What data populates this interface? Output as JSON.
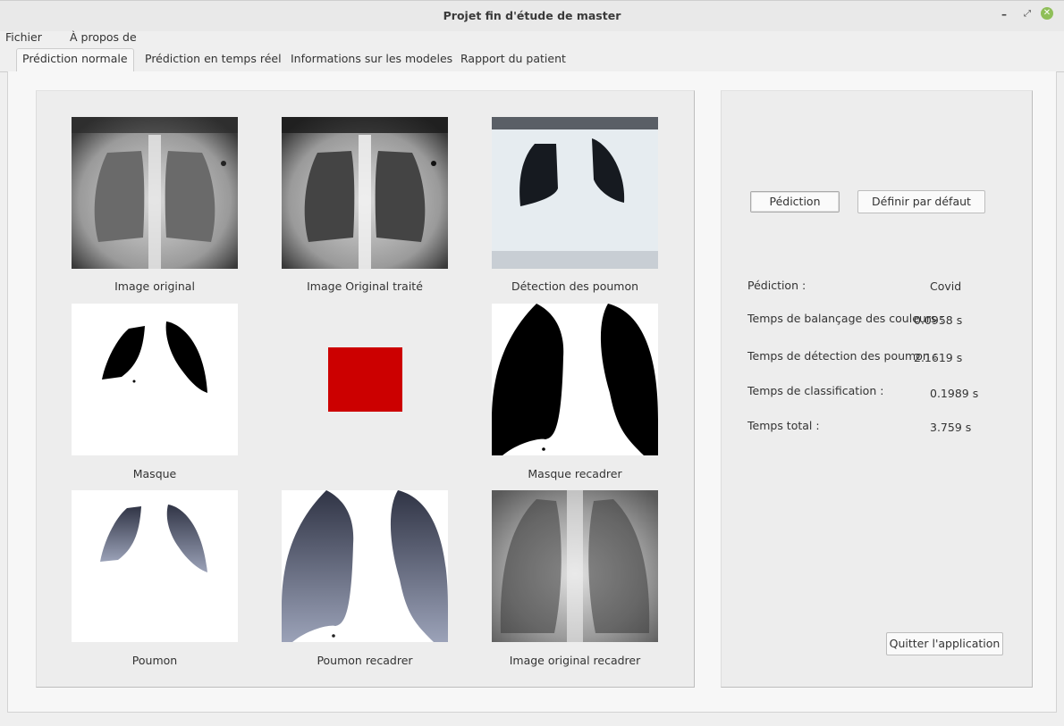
{
  "window": {
    "title": "Projet fin d'étude de master",
    "minimize_glyph": "–",
    "maximize_glyph": "⤢",
    "close_glyph": "✕"
  },
  "menu": {
    "items": [
      "Fichier",
      "À propos de"
    ]
  },
  "tabs": [
    "Prédiction normale",
    "Prédiction en temps réel",
    "Informations sur les modeles",
    "Rapport du patient"
  ],
  "images": [
    {
      "caption": "Image original",
      "icon": "chest-xray"
    },
    {
      "caption": "Image Original traité",
      "icon": "chest-xray-processed"
    },
    {
      "caption": "Détection des poumon",
      "icon": "lung-detection"
    },
    {
      "caption": "Masque",
      "icon": "lung-mask"
    },
    {
      "caption": "",
      "icon": "status-square"
    },
    {
      "caption": "Masque recadrer",
      "icon": "lung-mask-cropped"
    },
    {
      "caption": "Poumon",
      "icon": "lungs"
    },
    {
      "caption": "Poumon recadrer",
      "icon": "lungs-cropped"
    },
    {
      "caption": "Image original recadrer",
      "icon": "chest-xray-cropped"
    }
  ],
  "buttons": {
    "predict": "Pédiction",
    "reset": "Définir par défaut",
    "quit": "Quitter l'application"
  },
  "results": [
    {
      "label": "Pédiction :",
      "value": "Covid"
    },
    {
      "label": "Temps de balançage des couleurs :",
      "value": "0.0958 s"
    },
    {
      "label": "Temps de détection des poumon :",
      "value": "2.1619 s"
    },
    {
      "label": "Temps de classification :",
      "value": "0.1989 s"
    },
    {
      "label": "Temps total :",
      "value": "3.759 s"
    }
  ],
  "colors": {
    "status_square": "#cc0000",
    "close_button": "#8fbf59"
  }
}
